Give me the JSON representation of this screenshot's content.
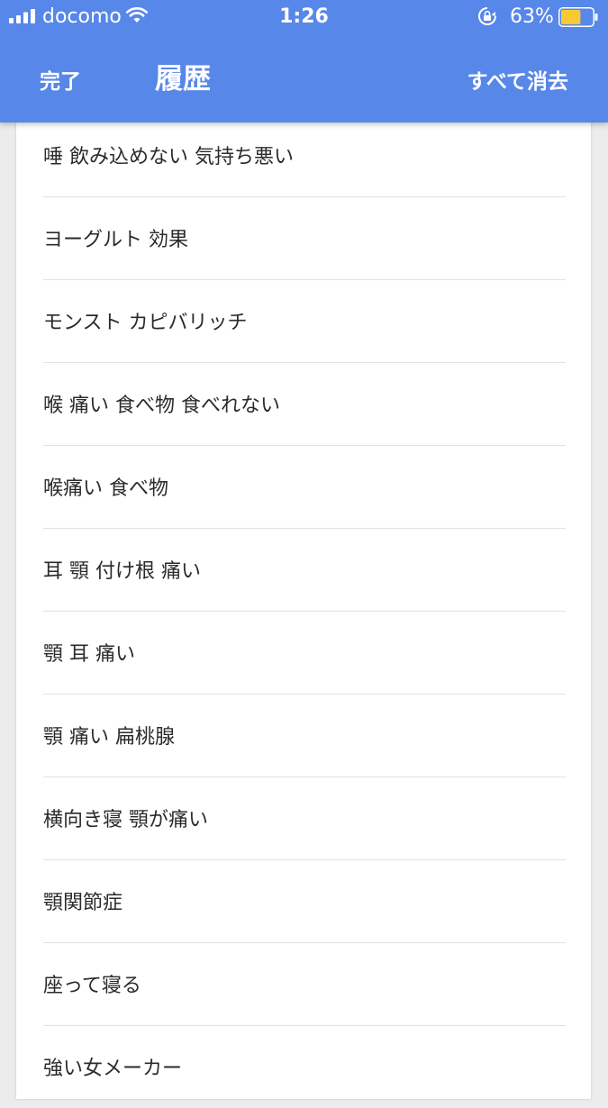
{
  "status_bar": {
    "carrier": "docomo",
    "time": "1:26",
    "battery_percent": "63%",
    "battery_level": 0.63,
    "battery_color": "#f7c933",
    "icons": [
      "signal-icon",
      "wifi-icon",
      "rotation-lock-icon",
      "battery-icon"
    ]
  },
  "header": {
    "done_label": "完了",
    "title": "履歴",
    "clear_all_label": "すべて消去",
    "background_color": "#5787e9"
  },
  "history": {
    "items": [
      "唾 飲み込めない 気持ち悪い",
      "ヨーグルト 効果",
      "モンスト カピバリッチ",
      "喉 痛い 食べ物 食べれない",
      "喉痛い 食べ物",
      "耳 顎 付け根 痛い",
      "顎 耳 痛い",
      "顎 痛い 扁桃腺",
      "横向き寝 顎が痛い",
      "顎関節症",
      "座って寝る",
      "強い女メーカー"
    ]
  }
}
